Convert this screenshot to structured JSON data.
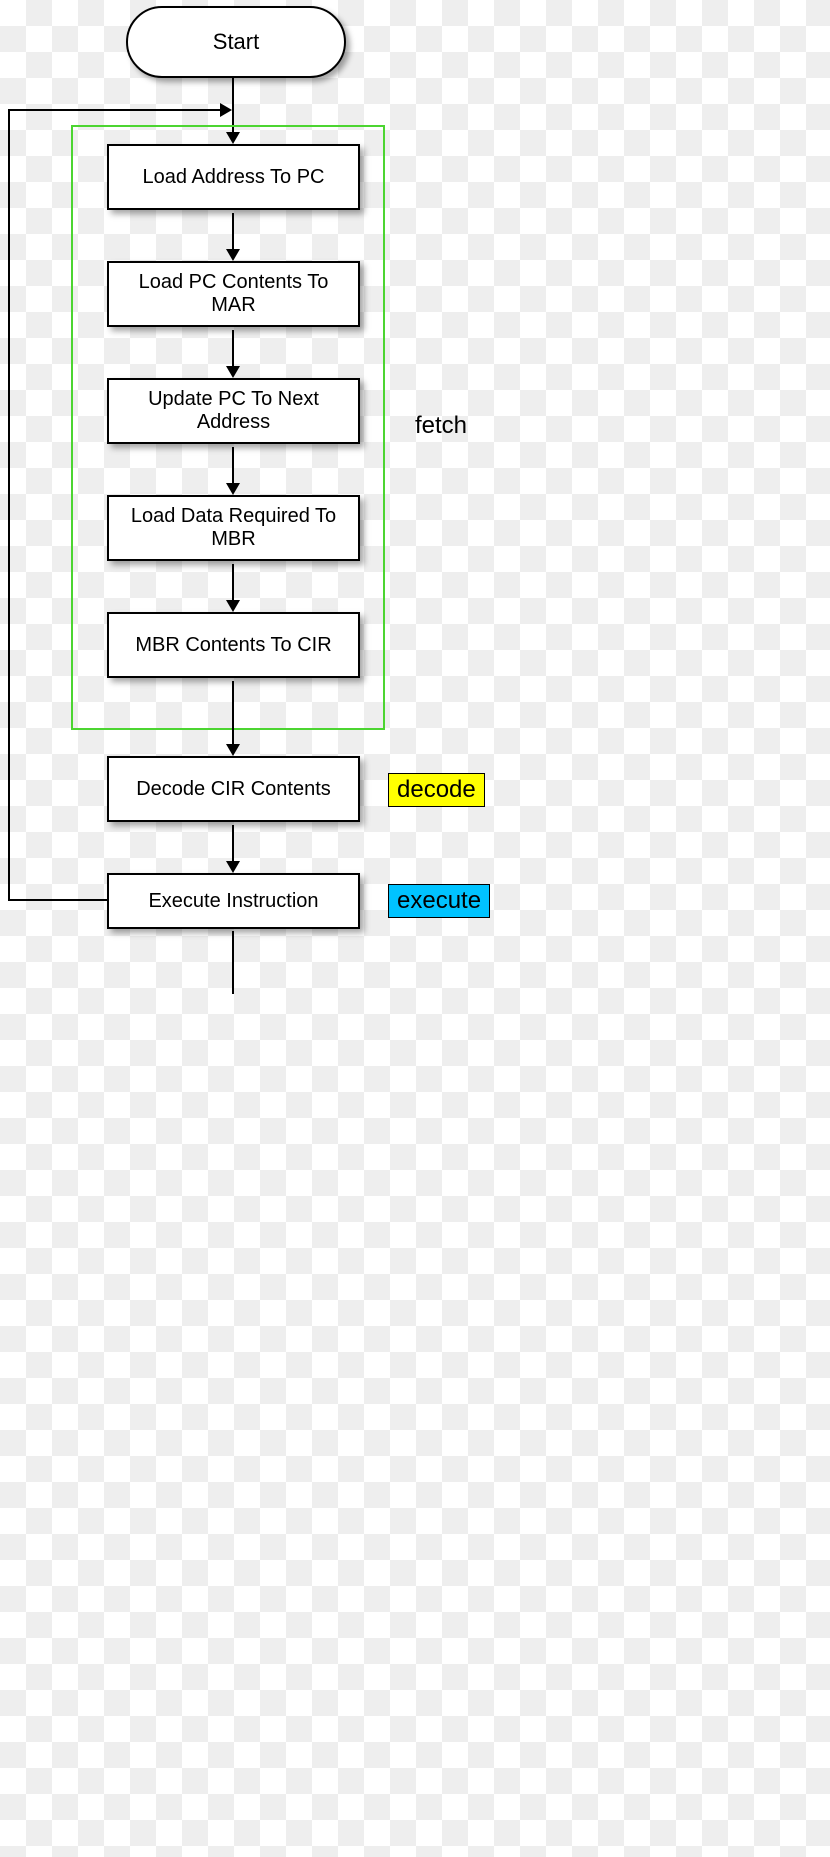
{
  "start": "Start",
  "steps": {
    "s1": "Load Address To PC",
    "s2": "Load PC Contents To MAR",
    "s3": "Update PC To Next Address",
    "s4": "Load Data Required To  MBR",
    "s5": "MBR  Contents To CIR",
    "s6": "Decode CIR Contents",
    "s7": "Execute Instruction"
  },
  "phases": {
    "fetch": "fetch",
    "decode": "decode",
    "execute": "execute"
  }
}
